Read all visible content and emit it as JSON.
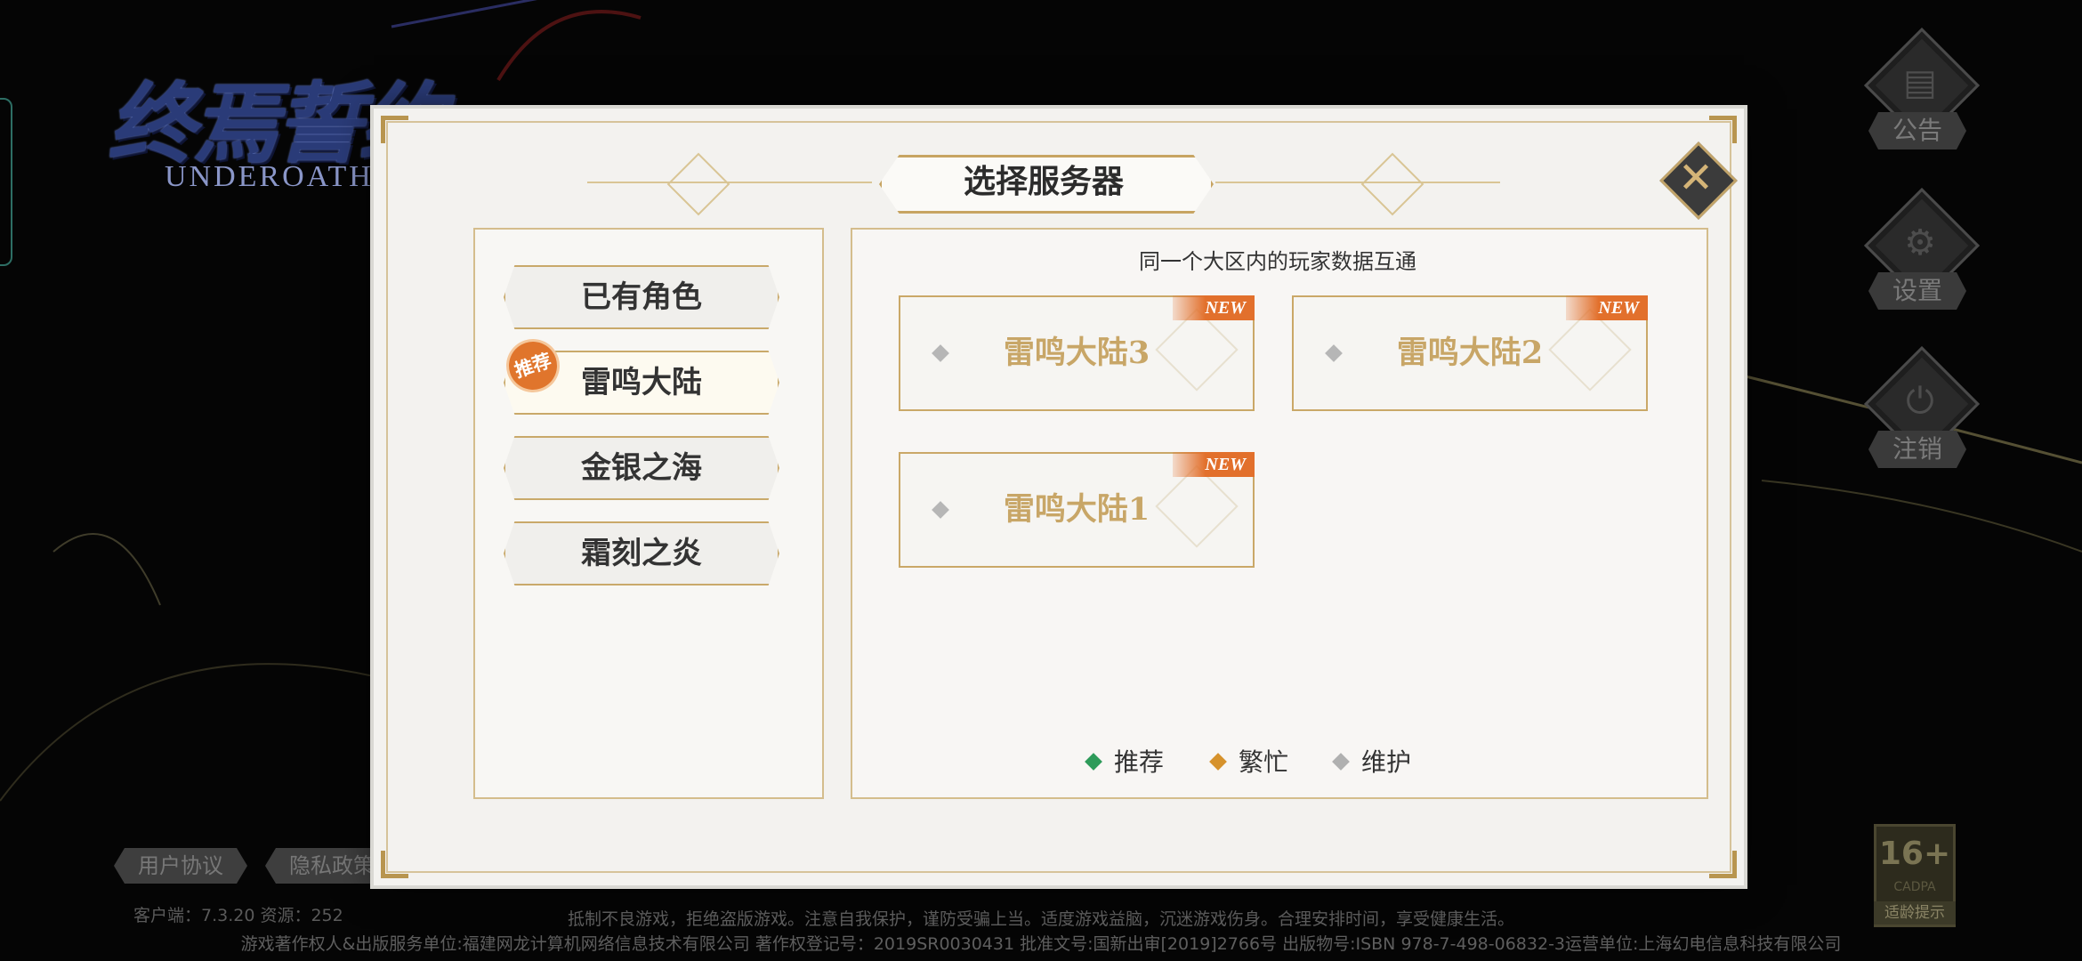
{
  "logo": {
    "main": "终焉誓约",
    "sub": "UNDEROATH"
  },
  "dialog": {
    "title": "选择服务器",
    "close_icon": "close-icon",
    "hint": "同一个大区内的玩家数据互通"
  },
  "regions": [
    {
      "label": "已有角色",
      "selected": false
    },
    {
      "label": "雷鸣大陆",
      "selected": true,
      "badge": "推荐"
    },
    {
      "label": "金银之海",
      "selected": false
    },
    {
      "label": "霜刻之炎",
      "selected": false
    }
  ],
  "servers": [
    {
      "name": "雷鸣大陆3",
      "tag": "NEW",
      "status": "maintenance"
    },
    {
      "name": "雷鸣大陆2",
      "tag": "NEW",
      "status": "maintenance"
    },
    {
      "name": "雷鸣大陆1",
      "tag": "NEW",
      "status": "maintenance"
    }
  ],
  "legend": [
    {
      "label": "推荐",
      "color": "#2e9b5a"
    },
    {
      "label": "繁忙",
      "color": "#d6922c"
    },
    {
      "label": "维护",
      "color": "#b0b0b0"
    }
  ],
  "side_nav": [
    {
      "label": "公告",
      "icon": "notice-icon"
    },
    {
      "label": "设置",
      "icon": "gear-icon"
    },
    {
      "label": "注销",
      "icon": "power-icon"
    }
  ],
  "bottom_links": {
    "agreement": "用户协议",
    "privacy": "隐私政策"
  },
  "version": "客户端：7.3.20  资源：252",
  "age_rating": {
    "num": "16+",
    "brand": "CADPA",
    "caption": "适龄提示"
  },
  "legal": {
    "line1": "抵制不良游戏，拒绝盗版游戏。注意自我保护，谨防受骗上当。适度游戏益脑，沉迷游戏伤身。合理安排时间，享受健康生活。",
    "line2": "游戏著作权人&出版服务单位:福建网龙计算机网络信息技术有限公司  著作权登记号：2019SR0030431  批准文号:国新出审[2019]2766号  出版物号:ISBN 978-7-498-06832-3运营单位:上海幻电信息科技有限公司"
  }
}
